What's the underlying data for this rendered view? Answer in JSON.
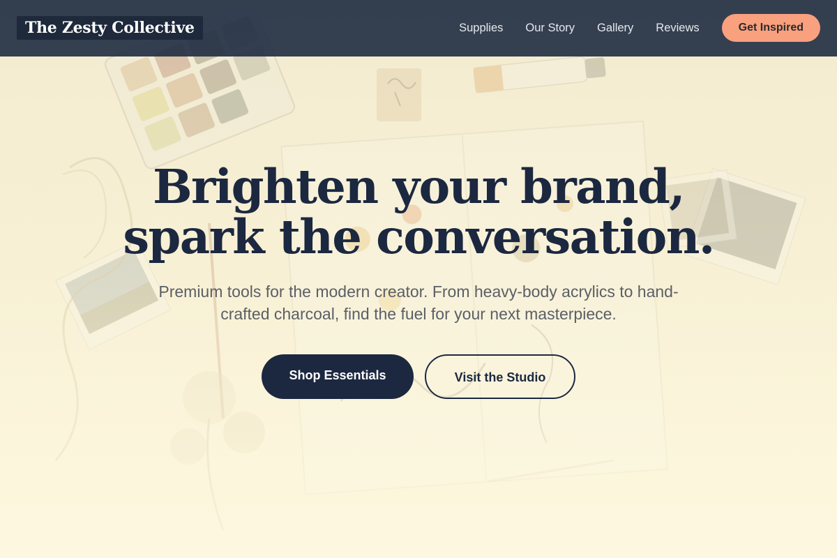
{
  "nav": {
    "brand": "The Zesty Collective",
    "links": [
      "Supplies",
      "Our Story",
      "Gallery",
      "Reviews"
    ],
    "cta": "Get Inspired"
  },
  "hero": {
    "title_lines": [
      "Brighten your brand,",
      "spark the conversation."
    ],
    "subtitle_lines": [
      "Premium tools for the modern creator. From heavy-body acrylics to hand-",
      "crafted charcoal, find the fuel for your next masterpiece."
    ],
    "primary_button": "Shop Essentials",
    "secondary_button": "Visit the Studio",
    "background_image": "art-supplies-flatlay"
  },
  "colors": {
    "navbar": "#233044",
    "brand_bg": "#1e293b",
    "accent": "#f9a07f",
    "heading": "#1c2840",
    "hero_bg": "#fbf5dc"
  }
}
